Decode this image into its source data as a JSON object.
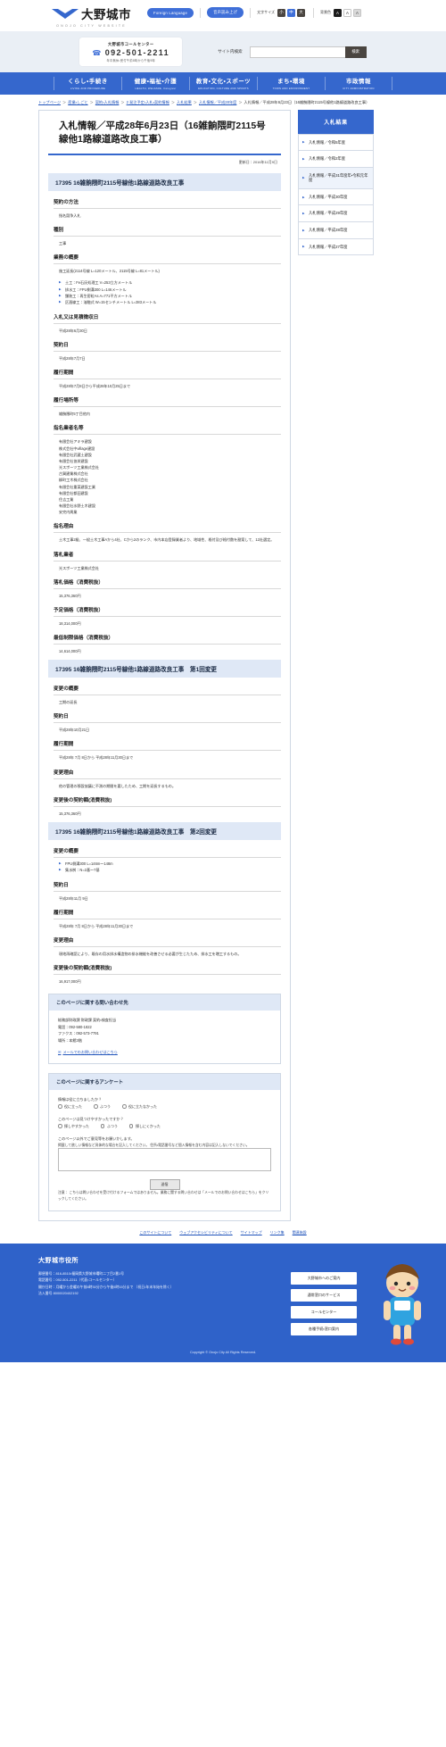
{
  "header": {
    "logo_text": "大野城市",
    "logo_sub": "ONOJO CITY WEBSITE",
    "foreign_language": "Foreign Language",
    "voice_read": "音声読み上げ",
    "font_size_label": "文字サイズ",
    "font_small": "小",
    "font_medium": "中",
    "font_large": "大",
    "bg_color_label": "背景色",
    "bg_black": "A",
    "bg_white": "A",
    "bg_grey": "A"
  },
  "callcenter": {
    "title": "大野城市コールセンター",
    "phone_icon": "phone-icon",
    "tel": "092-501-2211",
    "note": "年中無休・受付午前8時から午後9時"
  },
  "search": {
    "label": "サイト内検索",
    "value": "",
    "placeholder": "",
    "button": "検索"
  },
  "gnav": [
    {
      "ja": "くらし・手続き",
      "en": "LIVING AND PROCEDURE"
    },
    {
      "ja": "健康・福祉・介護",
      "en": "HEALTH, WELFARE, Caregiver"
    },
    {
      "ja": "教育・文化・スポーツ",
      "en": "EDUCATION, CULTURE AND SPORTS"
    },
    {
      "ja": "まち・環境",
      "en": "TOWN AND ENVIRONMENT"
    },
    {
      "ja": "市政情報",
      "en": "CITY ADMINISTRATION"
    }
  ],
  "breadcrumb": {
    "items": [
      "トップページ",
      "産業・しごと",
      "契約・入札情報",
      "2 発注予定・入札・契約情報",
      "入札結果",
      "入札情報／平成28年度"
    ],
    "current": "入札情報／平成28年6月23日（16雑餉隈町2115号線他1路線道路改良工事）",
    "separator": "＞"
  },
  "main": {
    "title": "入札情報／平成28年6月23日（16雑餉隈町2115号線他1路線道路改良工事）",
    "updated": "更新日：2016年11月9日",
    "sections": [
      {
        "heading": "17395 16雑餉隈町2115号線他1路線道路改良工事",
        "fields": [
          {
            "label": "契約の方法",
            "value": "指名競争入札"
          },
          {
            "label": "種別",
            "value": "工事"
          },
          {
            "label": "業務の概要",
            "value": "施工延長(2114号線 L=120メートル、2115号線 L=81メートル)",
            "bullets": [
              "土工：Fe石灰処理工 V=253立方メートル",
              "排水工：FPU側溝300 L=146メートル",
              "舗装工：再生密粒As A=771平方メートル",
              "区画線工：溶融式 W=15センチメートル L=383メートル"
            ]
          },
          {
            "label": "入札又は見積徴収日",
            "value": "平成28年6月30日"
          },
          {
            "label": "契約日",
            "value": "平成28年7月7日"
          },
          {
            "label": "履行期間",
            "value": "平成28年7月8日から平成28年10月25日まで"
          },
          {
            "label": "履行場所等",
            "value": "雑餉隈町5丁目他内"
          },
          {
            "label": "指名業者名等",
            "value": "有限会社アキラ建設\n株式会社中village建設\n有限会社武蔵土建設\n有限会社協栄建設\n光スポーツ工業株式会社\n古賀建業株式会社\n柳町工木株式会社\n有限会社重菜建設工業\n有限会社都田建設\n住吉工業\n有限会社水野土木建設\n安完内興業"
          },
          {
            "label": "指名理由",
            "value": "土木工事2級、一般土木工事Aから4社、Cから2のランク、市内本店登録業者より、地域性、格付及び格付数を勘案して、12社選定。"
          },
          {
            "label": "落札業者",
            "value": "光スポーツ工業株式会社"
          },
          {
            "label": "落札価格（消費税抜）",
            "value": "15,376,360円"
          },
          {
            "label": "予定価格（消費税抜）",
            "value": "18,314,000円"
          },
          {
            "label": "最低制限価格（消費税抜）",
            "value": "14,614,000円"
          }
        ]
      },
      {
        "heading": "17395 16雑餉隈町2115号線他1路線道路改良工事　第1回変更",
        "fields": [
          {
            "label": "変更の概要",
            "value": "工期の延長"
          },
          {
            "label": "契約日",
            "value": "平成28年10月21日"
          },
          {
            "label": "履行期間",
            "value": "平成28年 7月 8日から 平成28年11月30日まで"
          },
          {
            "label": "変更理由",
            "value": "他の管理の移設協議に不測の期間を要したため、工期を延長するもの。"
          },
          {
            "label": "変更後の契約額(消費税抜)",
            "value": "15,376,360円"
          }
        ]
      },
      {
        "heading": "17395 16雑餉隈町2115号線他1路線道路改良工事　第2回変更",
        "fields": [
          {
            "label": "変更の概要",
            "value": "",
            "bullets": [
              "FPU側溝300 L=146m～148m",
              "集水桝：N=2基～7基"
            ]
          },
          {
            "label": "契約日",
            "value": "平成28年11月 9日"
          },
          {
            "label": "履行期間",
            "value": "平成28年 7月 8日から 平成28年11月30日まで"
          },
          {
            "label": "変更理由",
            "value": "現地再確認により、既存の用水排水構造物の排水機能を改善させる必要が生じたため、排水工を増工するもの。"
          },
          {
            "label": "変更後の契約額(消費税抜)",
            "value": "16,917,000円"
          }
        ]
      }
    ]
  },
  "sidebar": {
    "heading": "入札結果",
    "items": [
      {
        "label": "入札情報／令和5年度",
        "active": false
      },
      {
        "label": "入札情報／令和2年度",
        "active": false
      },
      {
        "label": "入札情報／平成31年度年・令和元年度",
        "active": true
      },
      {
        "label": "入札情報／平成30年度",
        "active": false
      },
      {
        "label": "入札情報／平成29年度",
        "active": false
      },
      {
        "label": "入札情報／平成28年度",
        "active": false
      },
      {
        "label": "入札情報／平成27年度",
        "active": false
      }
    ]
  },
  "inquiry": {
    "heading": "このページに関する問い合わせ先",
    "dept": "総務部財政課 財政課 契約・検査担当",
    "tel": "電話：092-580-1822",
    "fax": "ファクス：092-573-7791",
    "place": "場所：本館3階",
    "mail_icon": "mail-icon",
    "mail_text": "メールでのお問い合わせはこちら"
  },
  "survey": {
    "heading": "このページに関するアンケート",
    "q1_label": "情報は役に立ちましたか？",
    "q1_options": [
      "役に立った",
      "ふつう",
      "役に立たなかった"
    ],
    "q2_label": "このページは見つけやすかったですか？",
    "q2_options": [
      "探しやすかった",
      "ふつう",
      "探しにくかった"
    ],
    "q3_label": "このページ以外でご意見等をお願いかします。",
    "q3_note": "掲載して欲しい情報など具体的な場合を記入してください。\n住所・電話番号など個人情報を含む内容は記入しないでください。",
    "textarea_value": "",
    "submit": "送信",
    "footnote": "注意：\nこちらは問い合わせを受け付けるフォームではありません。業務に関する問い合わせは「メールでのお問い合わせはこちら」をクリックしてください。"
  },
  "footer": {
    "links": [
      "このサイトについて",
      "ウェブアクセシビリティについて",
      "サイトマップ",
      "リンク集",
      "関連施設"
    ],
    "city": "大野城市役所",
    "address": "福岡県大野城市曙町二丁目2番1号",
    "postal": "郵便番号：816-8510・福岡県大野城市曙町二丁目2番1号",
    "tel": "電話番号：092-501-2211（代表・コールセンター）",
    "hours": "開庁日時：月曜から金曜の午前8時30分から午後5時15分まで\n（祝日・年末年始を除く）",
    "org_code": "法人番号 8000020402192",
    "buttons": [
      "大野城市へのご案内",
      "通常窓口のサービス"
    ],
    "buttons2": [
      "コールセンター",
      "各種手続・窓口案内"
    ],
    "mascot": "mascot-icon",
    "copyright": "Copyright © Onojo City All Rights Reserved."
  }
}
